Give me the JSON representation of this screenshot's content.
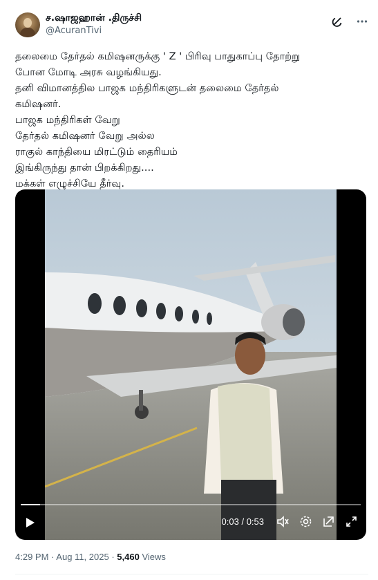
{
  "author": {
    "display_name": "ச.ஷாஜஹான் .திருச்சி",
    "handle": "@AcuranTivi"
  },
  "header_icons": [
    "grok-icon",
    "more-icon"
  ],
  "tweet": {
    "text": "தலைமை தேர்தல் கமிஷனருக்கு ' Z ' பிரிவு பாதுகாப்பு தோற்று\nபோன மோடி அரசு வழங்கியது.\nதனி விமானத்தில பாஜக மந்திரிகளுடன் தலைமை தேர்தல்\nகமிஷனர்.\nபாஜக மந்திரிகள் வேறு\nதேர்தல் கமிஷனர் வேறு அல்ல\nராகுல் காந்தியை மிரட்டும் தைரியம்\nஇங்கிருந்து தான் பிறக்கிறது....\nமக்கள் எழுச்சியே தீர்வு."
  },
  "video": {
    "current_time": "0:03",
    "duration": "0:53",
    "progress_fraction": 0.057,
    "icons": [
      "play-icon",
      "volume-icon",
      "settings-icon",
      "pip-icon",
      "fullscreen-icon"
    ]
  },
  "meta": {
    "time": "4:29 PM",
    "separator": "·",
    "date": "Aug 11, 2025",
    "views_count": "5,460",
    "views_label": "Views"
  },
  "colors": {
    "text": "#0f1419",
    "secondary": "#536471",
    "divider": "#eff3f4"
  }
}
